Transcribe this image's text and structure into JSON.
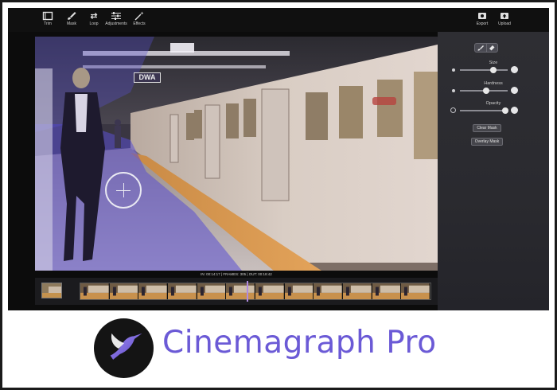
{
  "toolbar": {
    "left_tools": [
      {
        "label": "Trim",
        "icon": "trim-icon"
      },
      {
        "label": "Mask",
        "icon": "brush-icon"
      },
      {
        "label": "Loop",
        "icon": "loop-icon"
      },
      {
        "label": "Adjustments",
        "icon": "sliders-icon"
      },
      {
        "label": "Effects",
        "icon": "wand-icon"
      }
    ],
    "right_tools": [
      {
        "label": "Export",
        "icon": "export-icon"
      },
      {
        "label": "Upload",
        "icon": "upload-icon"
      }
    ]
  },
  "viewer": {
    "station_sign": "DWA"
  },
  "panel": {
    "size_label": "Size",
    "hardness_label": "Hardness",
    "opacity_label": "Opacity",
    "size_value": 0.7,
    "hardness_value": 0.55,
    "opacity_value": 0.95,
    "clear_mask": "Clear Mask",
    "overlay_mask": "Overlay Mask"
  },
  "timeline": {
    "timecode": "IN: 00:14:17 | FRAMES: 305 | OUT: 00:18:42",
    "frame_count_visible": 12
  },
  "brand": {
    "name": "Cinemagraph Pro",
    "color": "#6b5ad6"
  },
  "colors": {
    "accent": "#6b5ad6",
    "mask_overlay": "#5a4fd1",
    "playhead": "#b08ae0"
  }
}
